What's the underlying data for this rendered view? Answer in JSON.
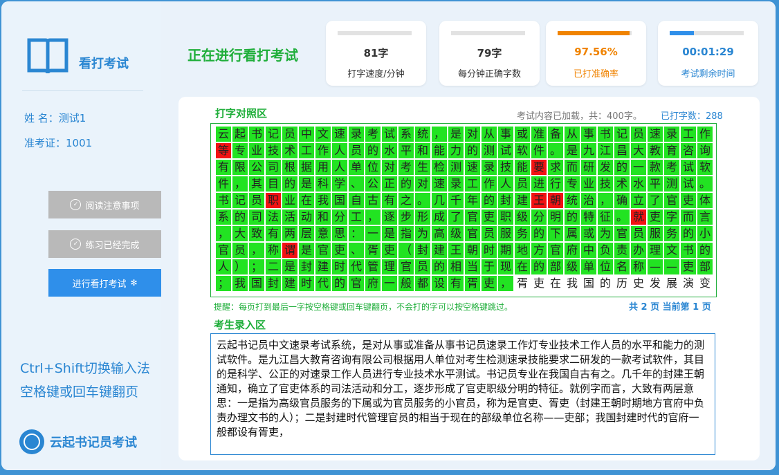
{
  "sidebar": {
    "title": "看打考试",
    "name_line": "姓 名：测试1",
    "id_line": "准考证：1001",
    "buttons": [
      {
        "label": "阅读注意事项",
        "state": "done"
      },
      {
        "label": "练习已经完成",
        "state": "done"
      },
      {
        "label": "进行看打考试",
        "state": "active"
      }
    ],
    "hint1": "Ctrl+Shift切换输入法",
    "hint2": "空格键或回车键翻页",
    "brand": "云起书记员考试"
  },
  "header": {
    "title": "正在进行看打考试",
    "stats": [
      {
        "value": "81字",
        "label": "打字速度/分钟",
        "color": "#333333",
        "label_color": "#333333",
        "bar_color": "#e2e2e2",
        "progress": 0
      },
      {
        "value": "79字",
        "label": "每分钟正确字数",
        "color": "#333333",
        "label_color": "#333333",
        "bar_color": "#e2e2e2",
        "progress": 0
      },
      {
        "value": "97.56%",
        "label": "已打准确率",
        "color": "#f08300",
        "label_color": "#f08300",
        "bar_color": "#f08300",
        "progress": 0.9756
      },
      {
        "value": "00:01:29",
        "label": "考试剩余时间",
        "color": "#2a86d2",
        "label_color": "#2a86d2",
        "bar_color": "#2f8fea",
        "progress": 0.33
      }
    ]
  },
  "compare": {
    "title": "打字对照区",
    "loaded": "考试内容已加载，共：400字。",
    "typed": "已打字数：288",
    "lines": [
      "云起书记员中文速录考试系统，是对从事或准备从事书记员速录工作",
      "等专业技术工作人员的水平和能力的测试软件。是九江昌大教育咨询",
      "有限公司根据用人单位对考生检测速录技能要求而研发的一款考试软",
      "件，其目的是科学、公正的对速录工作人员进行专业技术水平测试。",
      "书记员职业在我国自古有之。几千年的封建王朝统治，确立了官吏体",
      "系的司法活动和分工，逐步形成了官吏职级分明的特征。就吏字而言",
      "，大致有两层意思：一是指为高级官员服务的下属或为官员服务的小",
      "官员，称谓是官吏、胥吏（封建王朝时期地方官府中负责办理文书的",
      "人）；二是封建时代管理官员的相当于现在的部级单位名称——吏部",
      "；我国封建时代的官府一般都设有胥吏，胥吏在我国的历史发展演变"
    ],
    "errors": [
      [
        1,
        0
      ],
      [
        2,
        19
      ],
      [
        4,
        3
      ],
      [
        4,
        19
      ],
      [
        4,
        20
      ],
      [
        5,
        25
      ],
      [
        7,
        4
      ]
    ],
    "typed_count": 288,
    "tip": "提醒：每页打到最后一字按空格键或回车键翻页，不会打的字可以按空格键跳过。",
    "pager": "共 2 页 当前第 1 页"
  },
  "entry": {
    "title": "考生录入区",
    "text": "云起书记员中文速录考试系统，是对从事或准备从事书记员速录工作灯专业技术工作人员的水平和能力的测试软件。是九江昌大教育咨询有限公司根据用人单位对考生检测速录技能要求二研发的一款考试软件，其目的是科学、公正的对速录工作人员进行专业技术水平测试。书记员专业在我国自古有之。几千年的封建王朝通知，确立了官吏体系的司法活动和分工，逐步形成了官吏职级分明的特征。就例字而言，大致有两层意思：一是指为高级官员服务的下属或为官员服务的小官员，称为是官吏、胥吏（封建王朝时期地方官府中负责办理文书的人）；二是封建时代管理官员的相当于现在的部级单位名称——吏部；我国封建时代的官府一般都设有胥吏，"
  }
}
